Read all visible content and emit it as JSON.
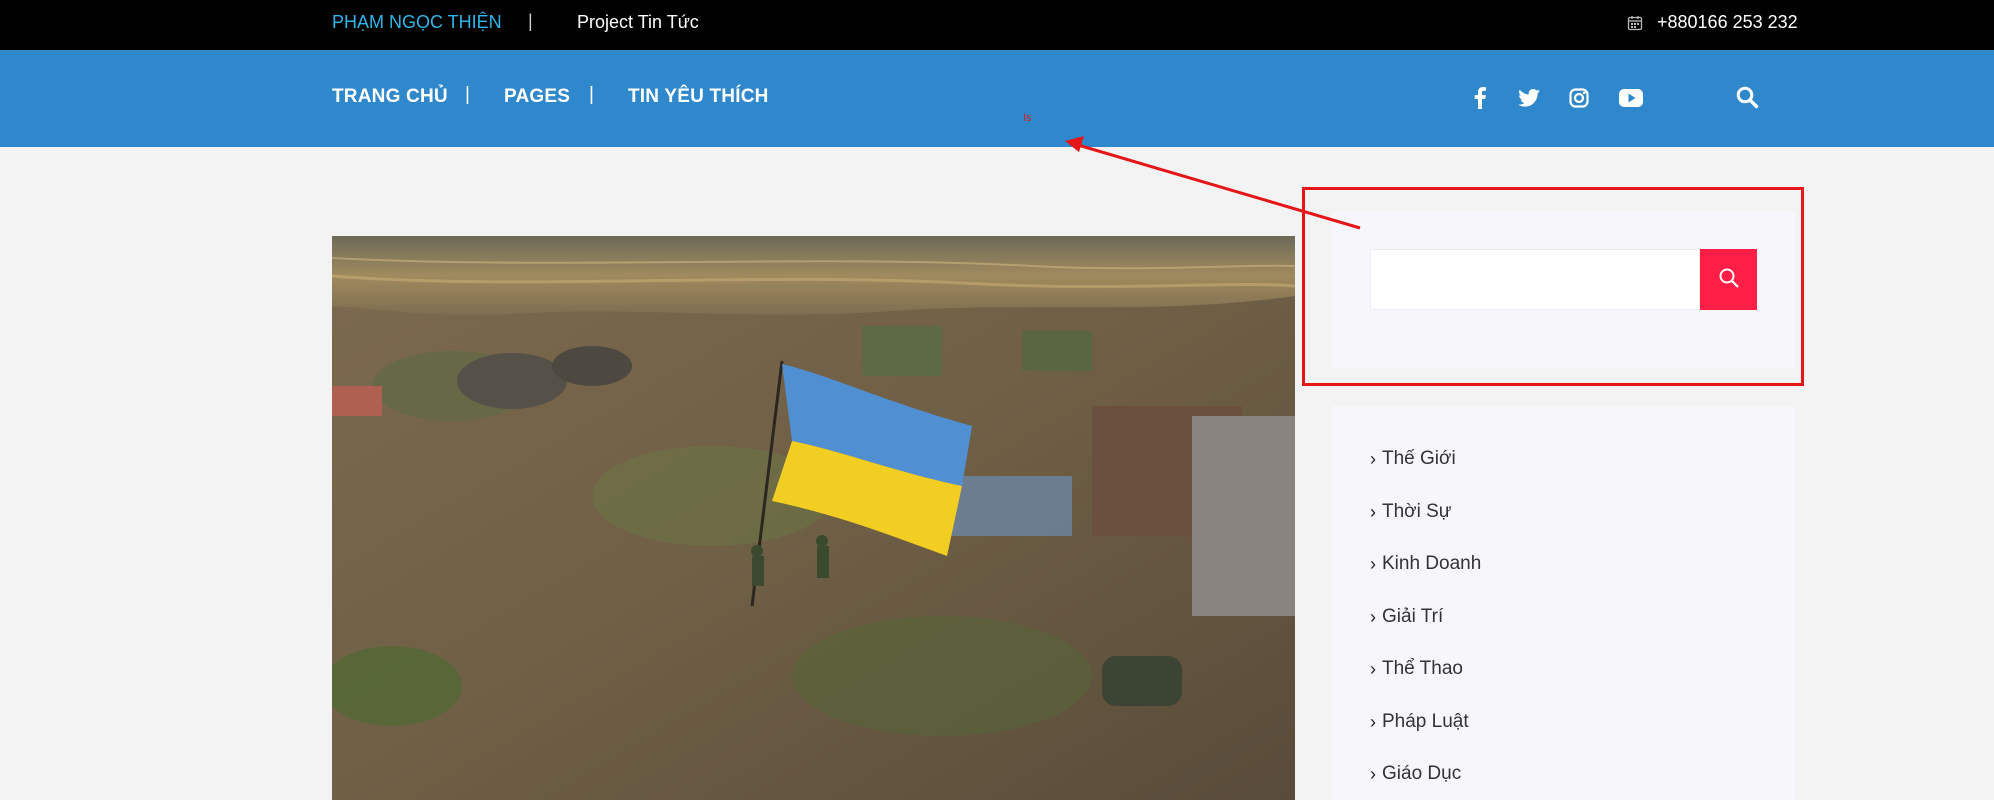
{
  "topbar": {
    "brand": "PHẠM NGỌC THIỆN",
    "separator": "|",
    "project": "Project Tin Tức",
    "phone": "+880166 253 232",
    "phone_icon": "calendar-icon"
  },
  "nav": {
    "items": [
      {
        "label": "TRANG CHỦ"
      },
      {
        "label": "PAGES"
      },
      {
        "label": "TIN YÊU THÍCH"
      }
    ],
    "separator": "|",
    "social_icons": [
      "facebook-icon",
      "twitter-icon",
      "instagram-icon",
      "youtube-icon"
    ],
    "search_icon": "search-icon"
  },
  "annotation": {
    "mark_text": "Is"
  },
  "sidebar": {
    "search": {
      "placeholder": "",
      "value": "",
      "button_icon": "search-icon"
    },
    "categories": [
      {
        "label": "Thế Giới"
      },
      {
        "label": "Thời Sự"
      },
      {
        "label": "Kinh Doanh"
      },
      {
        "label": "Giải Trí"
      },
      {
        "label": "Thể Thao"
      },
      {
        "label": "Pháp Luật"
      },
      {
        "label": "Giáo Dục"
      }
    ]
  },
  "colors": {
    "brand": "#2fb6ea",
    "nav_bg": "#3088cc",
    "accent": "#ff1e45",
    "annotation": "#e4161a"
  }
}
